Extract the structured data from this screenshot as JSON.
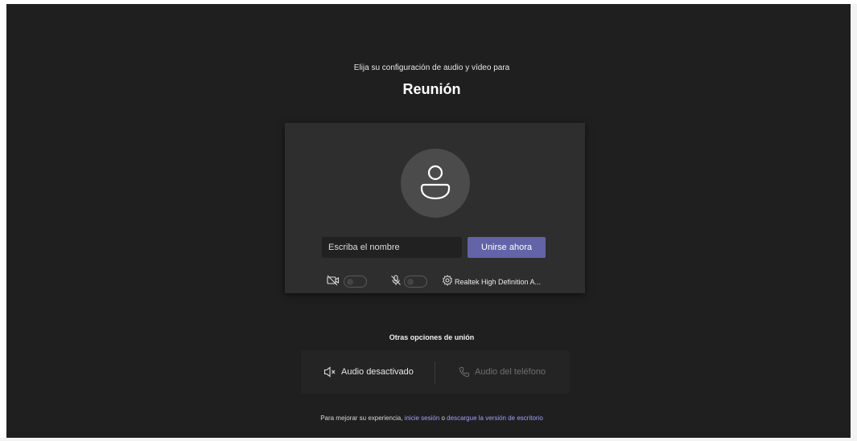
{
  "header": {
    "subtitle": "Elija su configuración de audio y vídeo para",
    "title": "Reunión"
  },
  "prejoin": {
    "name_placeholder": "Escriba el nombre",
    "join_label": "Unirse ahora",
    "controls": {
      "camera_icon": "camera-off-icon",
      "camera_on": false,
      "mic_icon": "mic-off-icon",
      "mic_on": false,
      "device_icon": "gear-icon",
      "device_label": "Realtek High Definition A..."
    }
  },
  "other_options": {
    "heading": "Otras opciones de unión",
    "audio_off_label": "Audio desactivado",
    "phone_audio_label": "Audio del teléfono"
  },
  "footer": {
    "prefix": "Para mejorar su experiencia, ",
    "signin_link": "inicie sesión",
    "middle": " o ",
    "download_link": "descargue la versión de escritorio"
  },
  "colors": {
    "background": "#1f1f1f",
    "panel": "#2e2e2e",
    "accent": "#6264a7",
    "link": "#9ea2ff"
  }
}
